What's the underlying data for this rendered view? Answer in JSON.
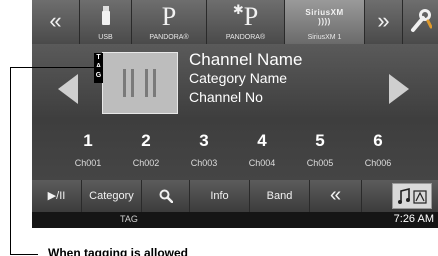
{
  "topbar": {
    "back_glyph": "«",
    "forward_glyph": "»",
    "sources": [
      {
        "label": "USB",
        "icon": "usb-icon"
      },
      {
        "label": "PANDORA®",
        "icon": "pandora-icon"
      },
      {
        "label": "PANDORA®",
        "icon": "bluetooth-pandora-icon"
      },
      {
        "label": "SiriusXM 1",
        "icon": "siriusxm-icon",
        "active": true
      }
    ],
    "settings_icon": "wrench-screwdriver-icon"
  },
  "channel": {
    "tag_badge": "TAG",
    "name": "Channel Name",
    "category": "Category Name",
    "number": "Channel No"
  },
  "presets": [
    {
      "num": "1",
      "ch": "Ch001"
    },
    {
      "num": "2",
      "ch": "Ch002"
    },
    {
      "num": "3",
      "ch": "Ch003"
    },
    {
      "num": "4",
      "ch": "Ch004"
    },
    {
      "num": "5",
      "ch": "Ch005"
    },
    {
      "num": "6",
      "ch": "Ch006"
    }
  ],
  "controls": {
    "play_pause": "▶/II",
    "category": "Category",
    "search_icon": "search-icon",
    "info": "Info",
    "band": "Band",
    "prev_page": "«",
    "audio_setup_icon": "music-note-icon"
  },
  "status": {
    "tag": "TAG",
    "clock": "7:26 AM"
  },
  "callout": {
    "text": "When tagging is allowed"
  }
}
